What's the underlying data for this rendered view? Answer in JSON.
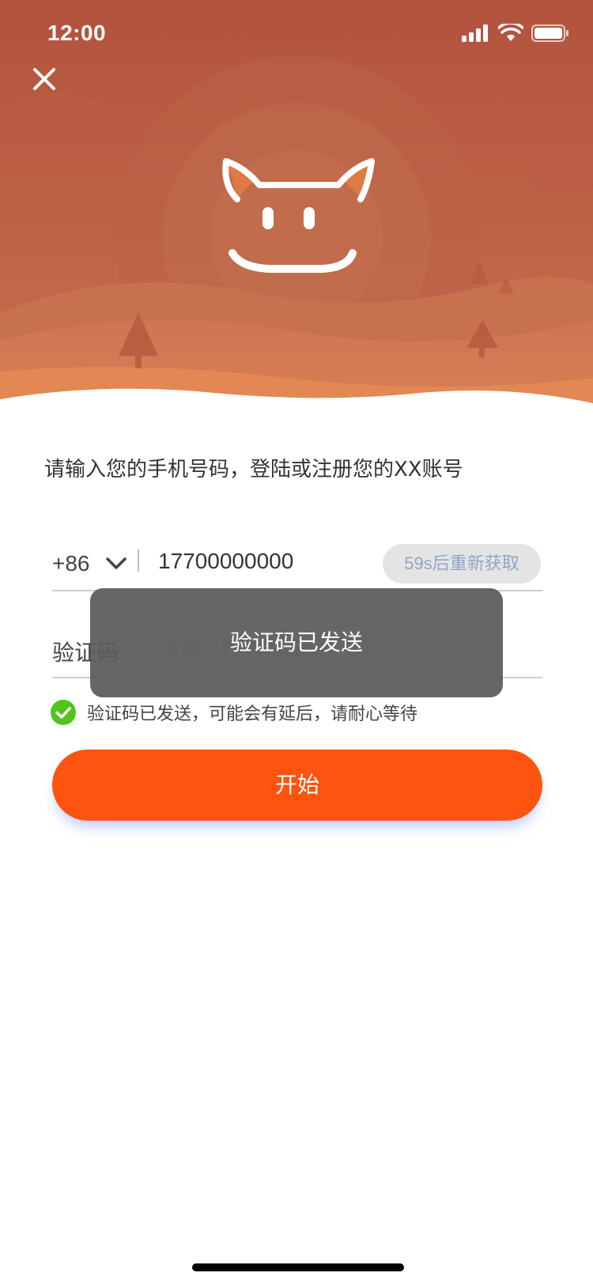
{
  "status_bar": {
    "time": "12:00"
  },
  "icons": {
    "close": "close-icon",
    "signal": "signal-icon",
    "wifi": "wifi-icon",
    "battery": "battery-icon",
    "mascot": "mascot-logo",
    "chevron": "chevron-down-icon",
    "check": "check-circle-icon"
  },
  "colors": {
    "accent": "#ff5310",
    "header": "#bf5f41",
    "success": "#52c41a"
  },
  "form": {
    "prompt": "请输入您的手机号码，登陆或注册您的XX账号",
    "country_code": "+86",
    "phone_value": "17700000000",
    "resend_label": "59s后重新获取",
    "code_label": "验证码",
    "code_placeholder": "请输入短信验证码",
    "hint": "验证码已发送，可能会有延后，请耐心等待",
    "submit_label": "开始"
  },
  "toast": {
    "message": "验证码已发送"
  }
}
